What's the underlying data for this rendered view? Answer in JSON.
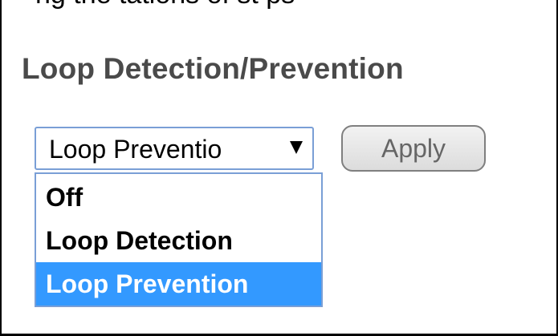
{
  "header_fragment": "ng  the  tations  of  st  ps",
  "page": {
    "title": "Loop Detection/Prevention"
  },
  "mode_select": {
    "value": "Loop Preventio",
    "arrow_icon": "triangle-down-icon",
    "options": [
      "Off",
      "Loop Detection",
      "Loop Prevention"
    ],
    "selected_option": "Loop Prevention"
  },
  "apply_button": {
    "label": "Apply"
  },
  "colors": {
    "title": "#4a4a4a",
    "selection_highlight": "#3399ff",
    "select_border": "#7a9fd6"
  }
}
